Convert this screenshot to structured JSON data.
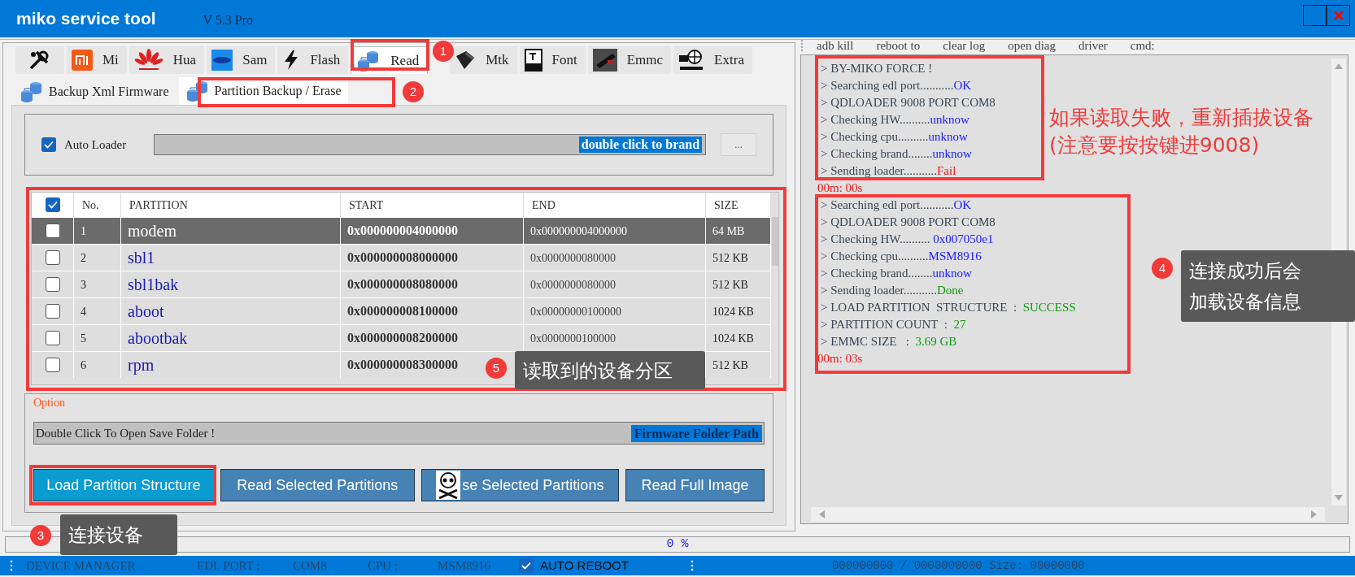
{
  "window": {
    "title": "miko service tool",
    "version": "V 5.3 Pro"
  },
  "tabs": [
    {
      "kind": "tools",
      "selected": false
    },
    {
      "kind": "mi",
      "label": "Mi",
      "selected": false
    },
    {
      "kind": "huawei",
      "label": "Hua",
      "selected": false
    },
    {
      "kind": "samsung",
      "label": "Sam",
      "selected": false
    },
    {
      "kind": "flash",
      "label": "Flash",
      "selected": false
    },
    {
      "kind": "read",
      "label": "Read",
      "selected": true
    },
    {
      "kind": "mtk",
      "label": "Mtk",
      "selected": false
    },
    {
      "kind": "font",
      "label": "Font",
      "selected": false
    },
    {
      "kind": "emmc",
      "label": "Emmc",
      "selected": false
    },
    {
      "kind": "extra",
      "label": "Extra",
      "selected": false
    }
  ],
  "subtabs": [
    {
      "label": "Backup Xml Firmware",
      "selected": false
    },
    {
      "label": "Partition Backup / Erase",
      "selected": true
    }
  ],
  "auto_loader": {
    "label": "Auto Loader",
    "checked": true,
    "field_value": "double click to brand",
    "browse_button": "..."
  },
  "table": {
    "header_checked": true,
    "columns": [
      "No.",
      "PARTITION",
      "START",
      "END",
      "SIZE"
    ],
    "rows": [
      {
        "checked": false,
        "selected": true,
        "no": "1",
        "partition": "modem",
        "start": "0x000000004000000",
        "end": "0x000000004000000",
        "size": "64 MB"
      },
      {
        "checked": false,
        "selected": false,
        "no": "2",
        "partition": "sbl1",
        "start": "0x000000008000000",
        "end": "0x0000000080000",
        "size": "512 KB"
      },
      {
        "checked": false,
        "selected": false,
        "no": "3",
        "partition": "sbl1bak",
        "start": "0x000000008080000",
        "end": "0x0000000080000",
        "size": "512 KB"
      },
      {
        "checked": false,
        "selected": false,
        "no": "4",
        "partition": "aboot",
        "start": "0x000000008100000",
        "end": "0x00000000100000",
        "size": "1024 KB"
      },
      {
        "checked": false,
        "selected": false,
        "no": "5",
        "partition": "abootbak",
        "start": "0x000000008200000",
        "end": "0x0000000100000",
        "size": "1024 KB"
      },
      {
        "checked": false,
        "selected": false,
        "no": "6",
        "partition": "rpm",
        "start": "0x000000008300000",
        "size": "512 KB"
      }
    ]
  },
  "option": {
    "title": "Option",
    "folder_hint": "Double Click To Open Save Folder !",
    "folder_label": "Firmware Folder Path"
  },
  "buttons": [
    {
      "label": "Load Partition Structure",
      "highlighted": true
    },
    {
      "label": "Read Selected Partitions",
      "highlighted": false
    },
    {
      "label": "se Selected Partitions",
      "highlighted": false,
      "kind": "skull"
    },
    {
      "label": "Read Full Image",
      "highlighted": false
    }
  ],
  "log_toolbar": [
    "adb kill",
    "reboot to",
    "clear log",
    "open diag",
    "driver",
    "cmd:"
  ],
  "log": [
    [
      {
        "kind": "plain",
        "text": "> BY-MIKO FORCE !"
      }
    ],
    [
      {
        "kind": "plain",
        "text": "> Searching edl port..........."
      },
      {
        "kind": "info",
        "text": "OK"
      }
    ],
    [
      {
        "kind": "plain",
        "text": "> QDLOADER 9008 PORT COM8"
      }
    ],
    [
      {
        "kind": "plain",
        "text": "> Checking HW.........."
      },
      {
        "kind": "info",
        "text": "unknow"
      }
    ],
    [
      {
        "kind": "plain",
        "text": "> Checking cpu.........."
      },
      {
        "kind": "info",
        "text": "unknow"
      }
    ],
    [
      {
        "kind": "plain",
        "text": "> Checking brand........"
      },
      {
        "kind": "info",
        "text": "unknow"
      }
    ],
    [
      {
        "kind": "plain",
        "text": "> Sending loader..........."
      },
      {
        "kind": "error",
        "text": "Fail"
      }
    ],
    [
      {
        "kind": "error",
        "text": "00m: 00s"
      }
    ],
    [
      {
        "kind": "plain",
        "text": "> Searching edl port..........."
      },
      {
        "kind": "info",
        "text": "OK"
      }
    ],
    [
      {
        "kind": "plain",
        "text": "> QDLOADER 9008 PORT COM8"
      }
    ],
    [
      {
        "kind": "plain",
        "text": "> Checking HW.......... "
      },
      {
        "kind": "info",
        "text": "0x007050e1"
      }
    ],
    [
      {
        "kind": "plain",
        "text": "> Checking cpu.........."
      },
      {
        "kind": "info",
        "text": "MSM8916"
      }
    ],
    [
      {
        "kind": "plain",
        "text": "> Checking brand........"
      },
      {
        "kind": "info",
        "text": "unknow"
      }
    ],
    [
      {
        "kind": "plain",
        "text": "> Sending loader..........."
      },
      {
        "kind": "success",
        "text": "Done"
      }
    ],
    [
      {
        "kind": "plain",
        "text": "> LOAD PARTITION  STRUCTURE  :  "
      },
      {
        "kind": "success",
        "text": "SUCCESS"
      }
    ],
    [
      {
        "kind": "plain",
        "text": "> PARTITION COUNT  :  "
      },
      {
        "kind": "success",
        "text": "27"
      }
    ],
    [
      {
        "kind": "plain",
        "text": "> EMMC SIZE   :  "
      },
      {
        "kind": "success",
        "text": "3.69 GB"
      }
    ],
    [
      {
        "kind": "error",
        "text": "00m: 03s"
      }
    ]
  ],
  "progress": {
    "text": "0 %",
    "level": 0
  },
  "status_bar": {
    "items": [
      "DEVICE MANAGER",
      "EDL PORT :",
      "COM8",
      "CPU :",
      "MSM8916"
    ],
    "auto_reboot": {
      "label": "AUTO REBOOT",
      "checked": true
    },
    "counter": "000000000 / 0000000000 Size: 00000000"
  },
  "annotations": {
    "note": [
      "如果读取失败，重新插拔设备",
      "(注意要按按键进9008)"
    ],
    "callouts": [
      {
        "number": "1"
      },
      {
        "number": "2"
      },
      {
        "number": "3",
        "text": [
          "连接设备"
        ]
      },
      {
        "number": "4",
        "text": [
          "连接成功后会",
          "加载设备信息"
        ]
      },
      {
        "number": "5",
        "text": [
          "读取到的设备分区"
        ]
      }
    ]
  }
}
